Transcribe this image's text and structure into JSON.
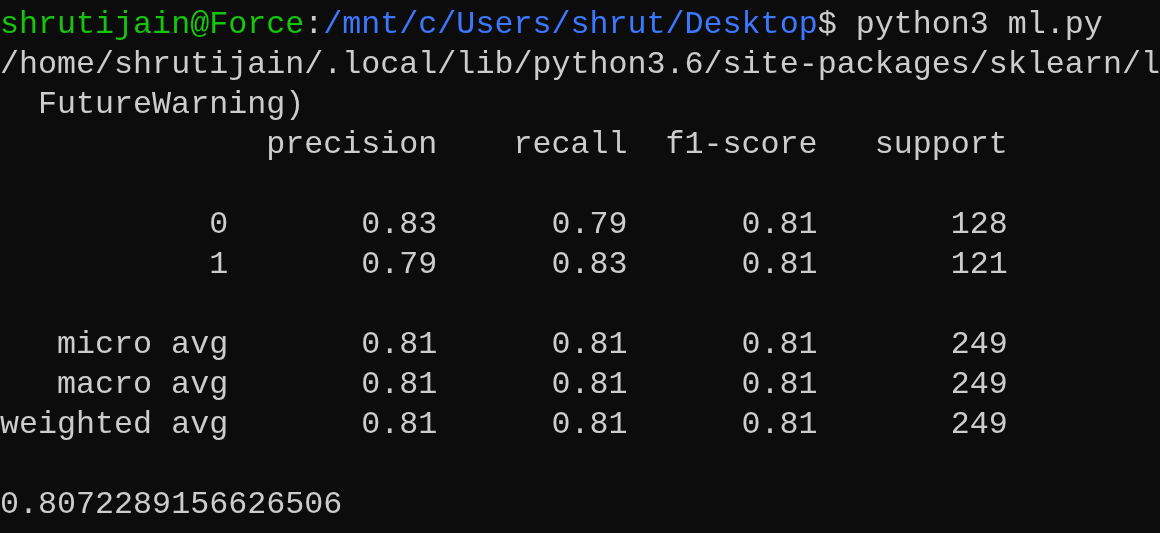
{
  "prompt": {
    "user_host": "shrutijain@Force",
    "separator": ":",
    "path": "/mnt/c/Users/shrut/Desktop",
    "symbol": "$",
    "command": "python3 ml.py"
  },
  "warning": {
    "path": "/home/shrutijain/.local/lib/python3.6/site-packages/sklearn/l",
    "text": "FutureWarning)"
  },
  "report": {
    "columns": [
      "precision",
      "recall",
      "f1-score",
      "support"
    ],
    "class_rows": [
      {
        "label": "0",
        "values": [
          "0.83",
          "0.79",
          "0.81",
          "128"
        ]
      },
      {
        "label": "1",
        "values": [
          "0.79",
          "0.83",
          "0.81",
          "121"
        ]
      }
    ],
    "avg_rows": [
      {
        "label": "micro avg",
        "values": [
          "0.81",
          "0.81",
          "0.81",
          "249"
        ]
      },
      {
        "label": "macro avg",
        "values": [
          "0.81",
          "0.81",
          "0.81",
          "249"
        ]
      },
      {
        "label": "weighted avg",
        "values": [
          "0.81",
          "0.81",
          "0.81",
          "249"
        ]
      }
    ]
  },
  "result": "0.8072289156626506"
}
